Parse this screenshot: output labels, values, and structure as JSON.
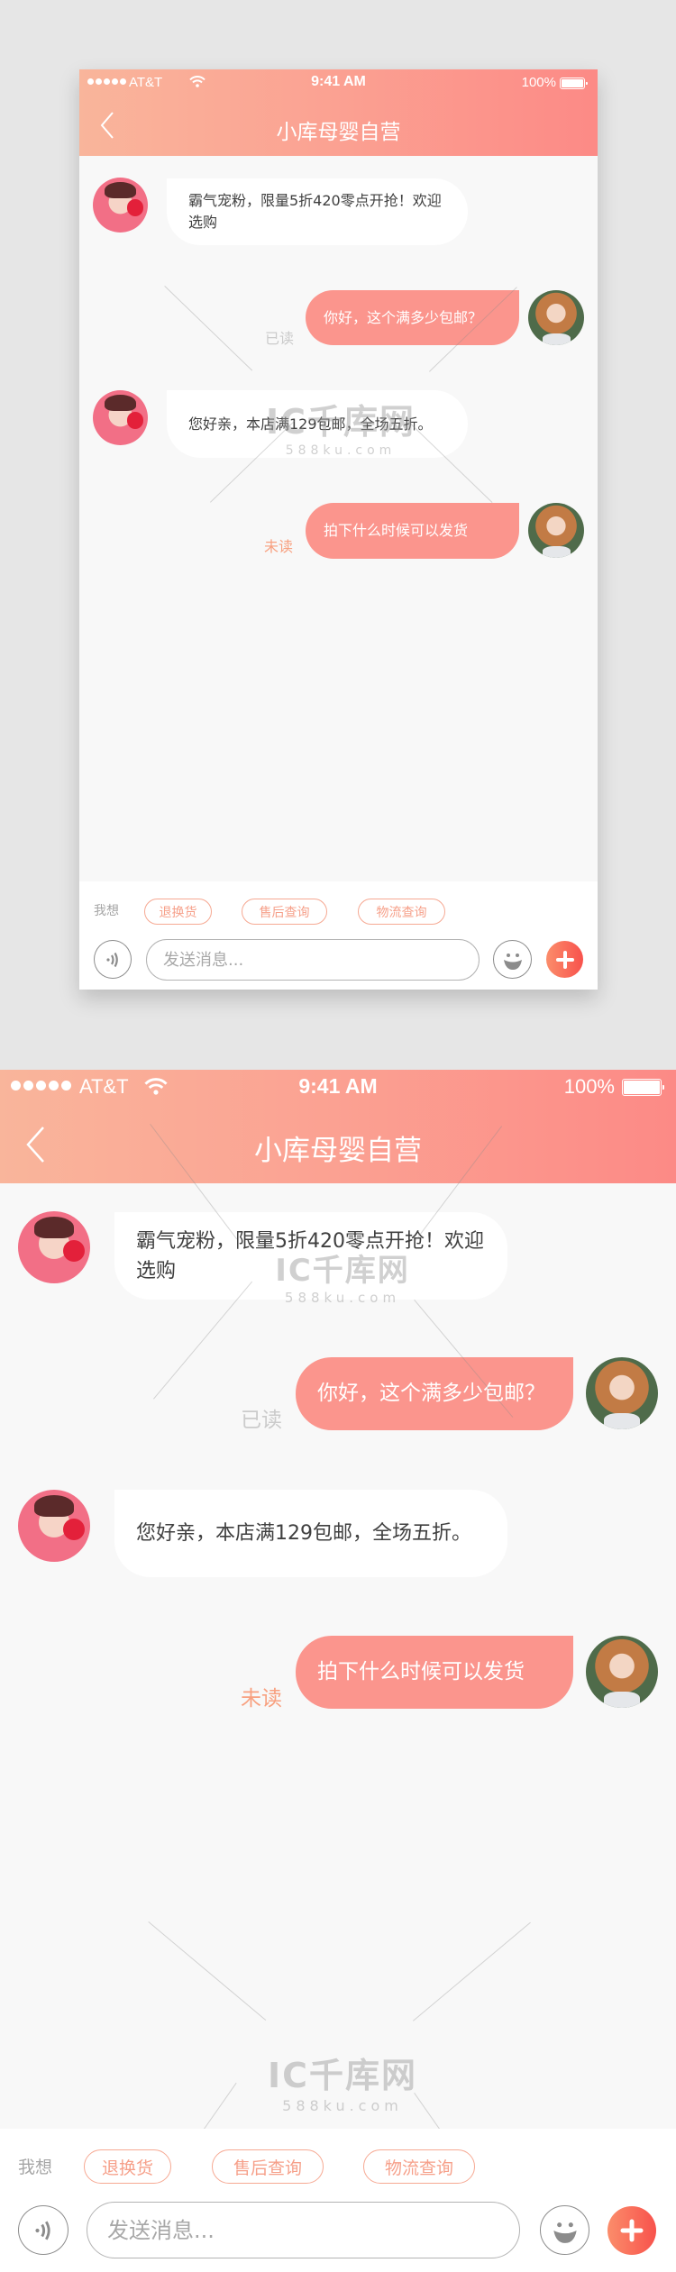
{
  "status_bar": {
    "carrier": "AT&T",
    "time": "9:41 AM",
    "battery": "100%",
    "signal_bars": 5
  },
  "header": {
    "title": "小库母婴自营",
    "back_icon": "chevron-left-icon"
  },
  "messages": [
    {
      "side": "incoming",
      "avatar": "shop-avatar",
      "text": "霸气宠粉，限量5折420零点开抢！欢迎选购"
    },
    {
      "side": "outgoing",
      "avatar": "user-avatar",
      "text": "你好，这个满多少包邮？",
      "status": "已读"
    },
    {
      "side": "incoming",
      "avatar": "shop-avatar",
      "text": "您好亲，本店满129包邮，全场五折。"
    },
    {
      "side": "outgoing",
      "avatar": "user-avatar",
      "text": "拍下什么时候可以发货",
      "status": "未读"
    }
  ],
  "quick_replies": {
    "label": "我想",
    "tags": [
      "退换货",
      "售后查询",
      "物流查询"
    ]
  },
  "composer": {
    "placeholder": "发送消息...",
    "value": "",
    "voice_icon": "voice-icon",
    "emoji_icon": "emoji-icon",
    "plus_icon": "plus-icon"
  },
  "watermark": {
    "logo": "IC千库网",
    "url": "588ku.com"
  },
  "colors": {
    "header_gradient_start": "#f9b59b",
    "header_gradient_end": "#fc8a86",
    "outgoing_bubble": "#fb958d",
    "incoming_bubble": "#ffffff",
    "tag_accent": "#f6a08a",
    "read_status": "#cbcbcb",
    "unread_status": "#f8a07f",
    "plus_button_start": "#fb8d6b",
    "plus_button_end": "#f8524c"
  }
}
